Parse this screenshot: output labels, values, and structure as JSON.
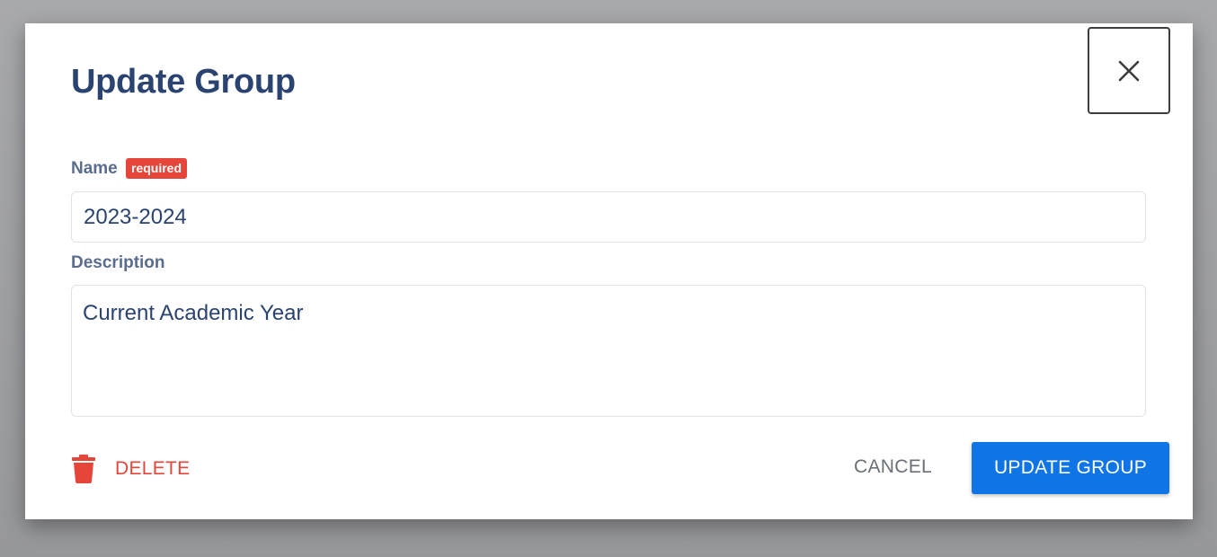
{
  "dialog": {
    "title": "Update Group",
    "fields": {
      "name": {
        "label": "Name",
        "badge": "required",
        "value": "2023-2024"
      },
      "description": {
        "label": "Description",
        "value": "Current Academic Year"
      }
    },
    "actions": {
      "delete_label": "DELETE",
      "cancel_label": "CANCEL",
      "submit_label": "UPDATE GROUP"
    },
    "icons": {
      "close": "close-icon",
      "delete": "trash-icon"
    },
    "colors": {
      "title": "#2b4370",
      "primary": "#0f74e6",
      "danger": "#e6453a",
      "label": "#5b6d8e"
    }
  }
}
